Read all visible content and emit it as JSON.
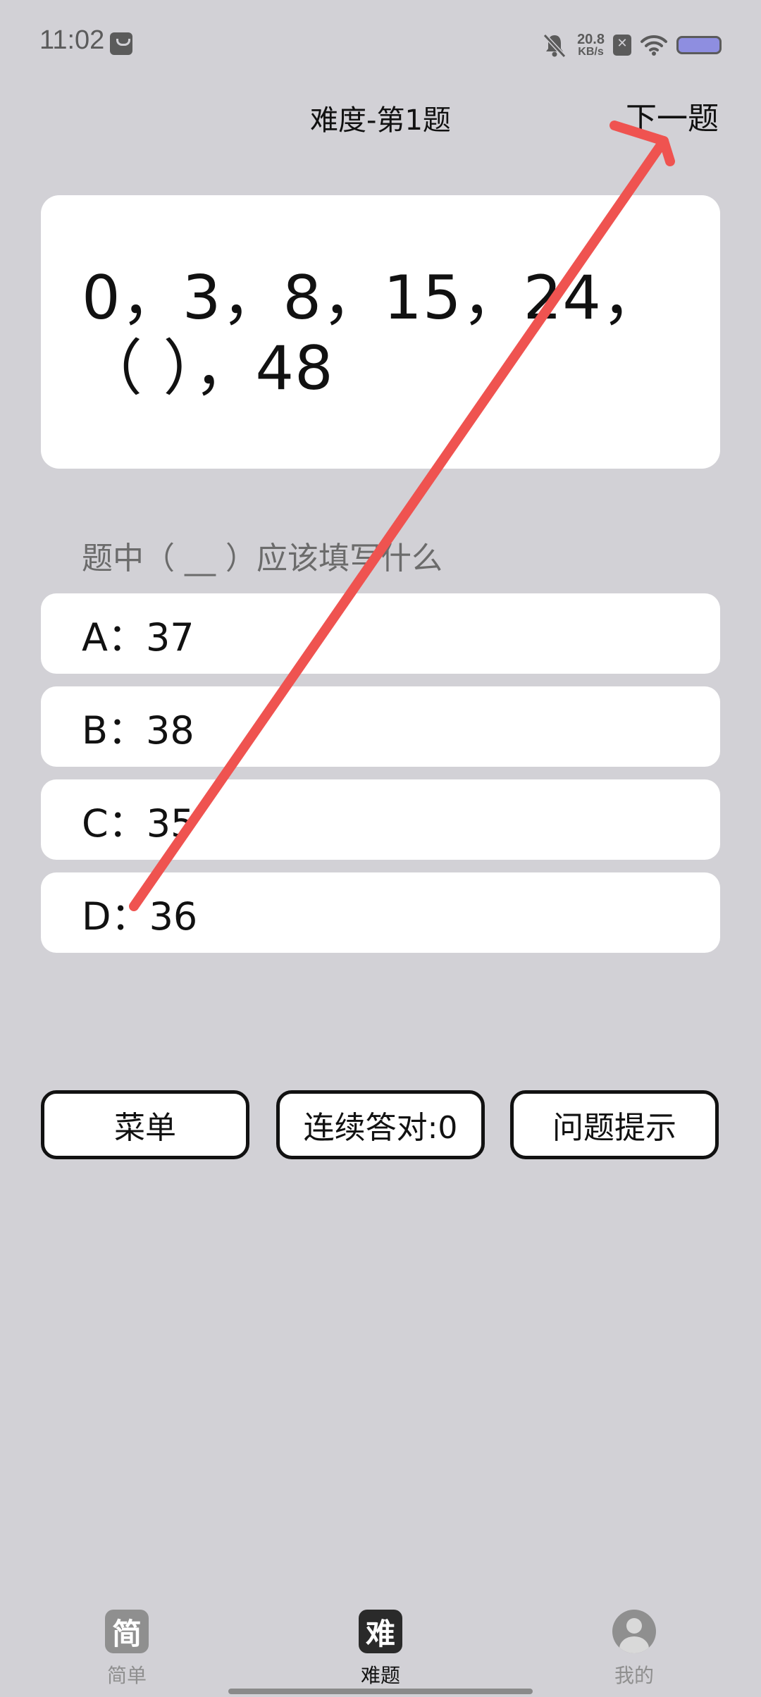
{
  "status_bar": {
    "time": "11:02",
    "net_speed_value": "20.8",
    "net_speed_unit": "KB/s"
  },
  "header": {
    "title": "难度-第1题",
    "next_label": "下一题"
  },
  "question": {
    "text": "0，3，8，15，24，（ ），48",
    "prompt": "题中（ __ ）应该填写什么"
  },
  "options": [
    {
      "label": "A：37"
    },
    {
      "label": "B：38"
    },
    {
      "label": "C：35"
    },
    {
      "label": "D：36"
    }
  ],
  "actions": {
    "menu_label": "菜单",
    "streak_label": "连续答对:0",
    "hint_label": "问题提示"
  },
  "bottom_nav": {
    "items": [
      {
        "icon_char": "简",
        "label": "简单",
        "icon": "easy-icon"
      },
      {
        "icon_char": "难",
        "label": "难题",
        "icon": "hard-icon",
        "active": true
      },
      {
        "label": "我的",
        "icon": "profile-icon"
      }
    ]
  },
  "colors": {
    "background": "#d2d1d6",
    "card": "#ffffff",
    "annotation_arrow": "#ef5350"
  }
}
